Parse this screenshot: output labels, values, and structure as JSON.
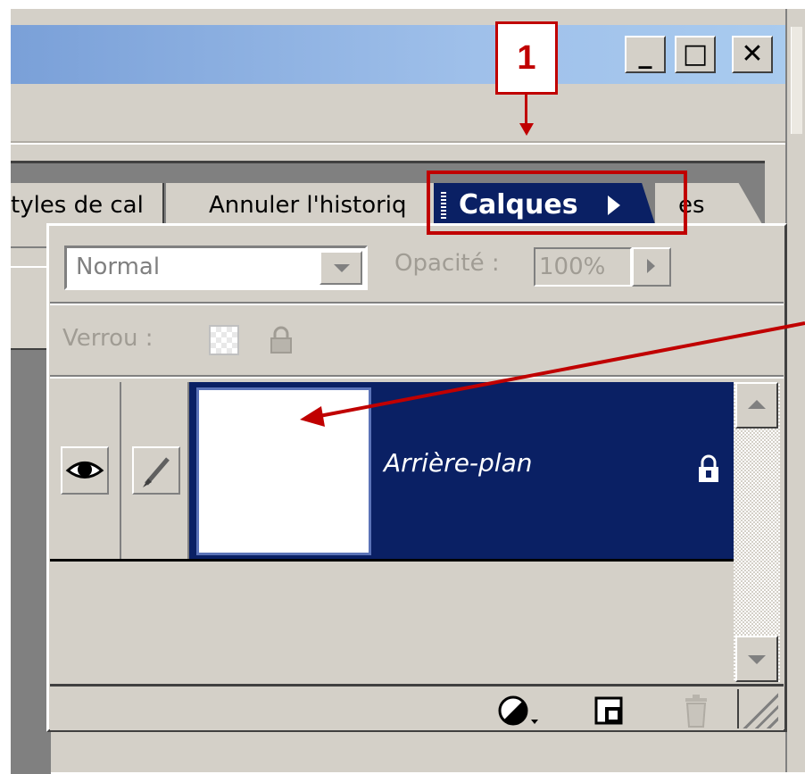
{
  "window": {
    "minimize_label": "_",
    "maximize_label": "□",
    "close_label": "✕"
  },
  "tabs": [
    {
      "label": "tyles de cal",
      "active": false
    },
    {
      "label": "Annuler l'historiq",
      "active": false
    },
    {
      "label": "Calques",
      "active": true
    },
    {
      "label": "es",
      "active": false
    }
  ],
  "annotation": {
    "step_number": "1",
    "color": "#c00000"
  },
  "panel": {
    "blend_mode": "Normal",
    "opacity_label": "Opacité :",
    "opacity_value": "100%",
    "lock_label": "Verrou :"
  },
  "layers": [
    {
      "name": "Arrière-plan",
      "visible": true,
      "locked": true,
      "selected": true
    }
  ],
  "icons": {
    "visibility": "eye-icon",
    "paint": "brush-icon",
    "lock": "lock-icon",
    "transparency_lock": "checkerboard-icon",
    "adjustment": "half-circle-icon",
    "new_layer": "new-layer-icon",
    "delete": "trash-icon"
  },
  "colors": {
    "selection": "#0a2064",
    "face": "#d4d0c8",
    "title_start": "#7aa0d8",
    "title_end": "#a9cbef"
  }
}
